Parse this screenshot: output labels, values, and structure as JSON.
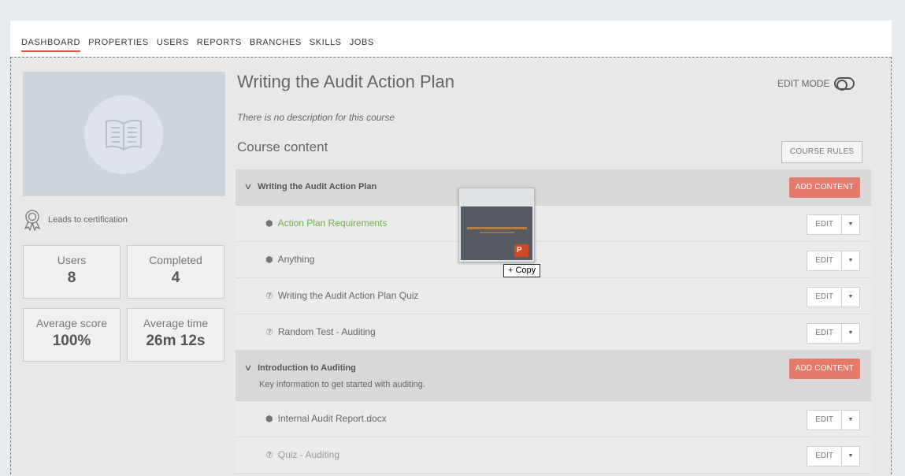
{
  "nav": {
    "items": [
      "DASHBOARD",
      "PROPERTIES",
      "USERS",
      "REPORTS",
      "BRANCHES",
      "SKILLS",
      "JOBS"
    ]
  },
  "course": {
    "title": "Writing the Audit Action Plan",
    "edit_mode_label": "EDIT MODE",
    "description": "There is no description for this course",
    "content_heading": "Course content",
    "rules_button": "COURSE RULES"
  },
  "sidebar": {
    "cert_label": "Leads to certification",
    "icon": "book-icon",
    "stats": [
      {
        "label": "Users",
        "value": "8"
      },
      {
        "label": "Completed",
        "value": "4"
      },
      {
        "label": "Average score",
        "value": "100%"
      },
      {
        "label": "Average time",
        "value": "26m 12s"
      }
    ]
  },
  "sections": [
    {
      "title": "Writing the Audit Action Plan",
      "add_button": "ADD CONTENT",
      "items": [
        {
          "label": "Action Plan Requirements",
          "icon": "box-icon",
          "edit": "EDIT"
        },
        {
          "label": "Anything",
          "icon": "box-icon",
          "edit": "EDIT"
        },
        {
          "label": "Writing the Audit Action Plan Quiz",
          "icon": "question-icon",
          "edit": "EDIT"
        },
        {
          "label": "Random Test - Auditing",
          "icon": "question-icon",
          "edit": "EDIT"
        }
      ]
    },
    {
      "title": "Introduction to Auditing",
      "description": "Key information to get started with auditing.",
      "add_button": "ADD CONTENT",
      "items": [
        {
          "label": "Internal Audit Report.docx",
          "icon": "box-icon",
          "edit": "EDIT"
        },
        {
          "label": "Quiz - Auditing",
          "icon": "question-icon",
          "edit": "EDIT"
        }
      ]
    }
  ],
  "drag": {
    "copy_label": "+ Copy",
    "ppt_badge": "P"
  },
  "colors": {
    "accent": "#e57a6a",
    "active_tab_underline": "#d9534f",
    "link_green": "#6ab04c"
  }
}
